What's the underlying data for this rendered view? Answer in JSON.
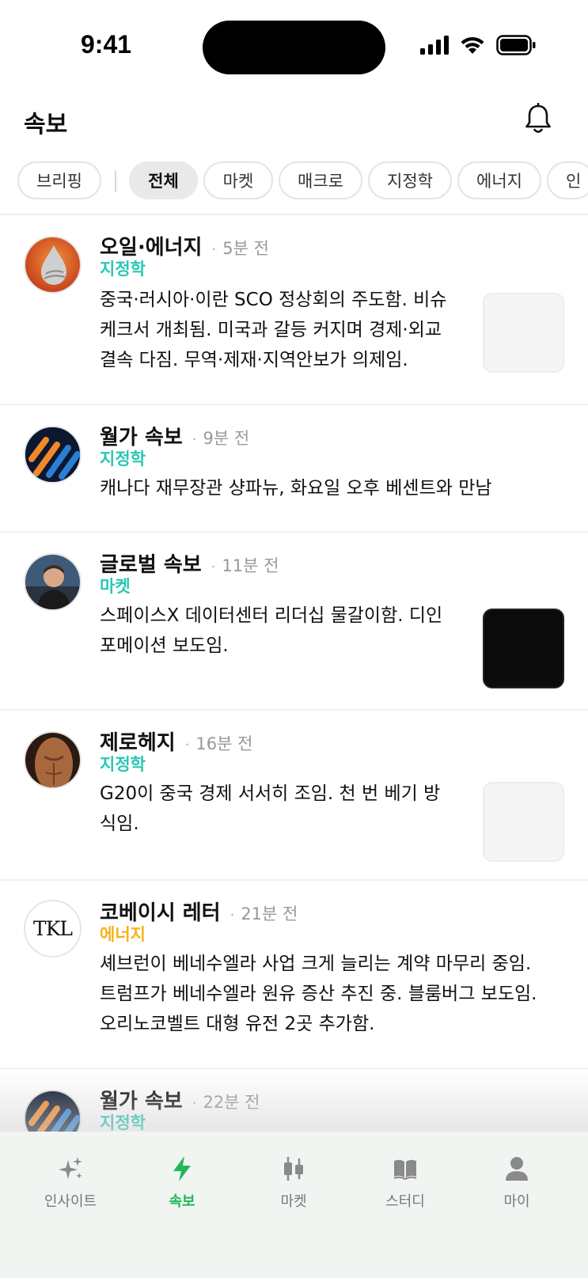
{
  "status_bar": {
    "time": "9:41"
  },
  "header": {
    "title": "속보"
  },
  "filters": {
    "chips": [
      "브리핑",
      "전체",
      "마켓",
      "매크로",
      "지정학",
      "에너지",
      "인"
    ],
    "active_index": 1
  },
  "posts": [
    {
      "author": "오일·에너지",
      "dot": "·",
      "time": "5분 전",
      "tag": "지정학",
      "lines": [
        "중국·러시아·이란 SCO 정상회의 주도함. 비슈",
        "케크서 개최됨. 미국과 갈등 커지며 경제·외교",
        "결속 다짐. 무역·제재·지역안보가 의제임."
      ]
    },
    {
      "author": "월가 속보",
      "dot": "·",
      "time": "9분 전",
      "tag": "지정학",
      "lines": [
        "캐나다 재무장관 샹파뉴, 화요일 오후 베센트와 만남"
      ]
    },
    {
      "author": "글로벌 속보",
      "dot": "·",
      "time": "11분 전",
      "tag": "마켓",
      "lines": [
        "스페이스X 데이터센터 리더십 물갈이함. 디인",
        "포메이션 보도임."
      ]
    },
    {
      "author": "제로헤지",
      "dot": "·",
      "time": "16분 전",
      "tag": "지정학",
      "lines": [
        "G20이 중국 경제 서서히 조임. 천 번 베기 방",
        "식임."
      ]
    },
    {
      "author": "코베이시 레터",
      "dot": "·",
      "time": "21분 전",
      "tag": "에너지",
      "avatar_text": "TKL",
      "lines": [
        "셰브런이 베네수엘라 사업 크게 늘리는 계약 마무리 중임.",
        "트럼프가 베네수엘라 원유 증산 추진 중. 블룸버그 보도임.",
        "오리노코벨트 대형 유전 2곳 추가함."
      ]
    },
    {
      "author": "월가 속보",
      "dot": "·",
      "time": "22분 전",
      "tag": "지정학"
    }
  ],
  "tabbar": {
    "tabs": [
      {
        "label": "인사이트",
        "icon": "sparkles-icon"
      },
      {
        "label": "속보",
        "icon": "lightning-icon"
      },
      {
        "label": "마켓",
        "icon": "candlestick-icon"
      },
      {
        "label": "스터디",
        "icon": "book-icon"
      },
      {
        "label": "마이",
        "icon": "person-icon"
      }
    ],
    "active_index": 1
  },
  "colors": {
    "accent": "#1fb85a",
    "tag_teal": "#27c7b4",
    "tag_amber": "#f5b21a"
  }
}
